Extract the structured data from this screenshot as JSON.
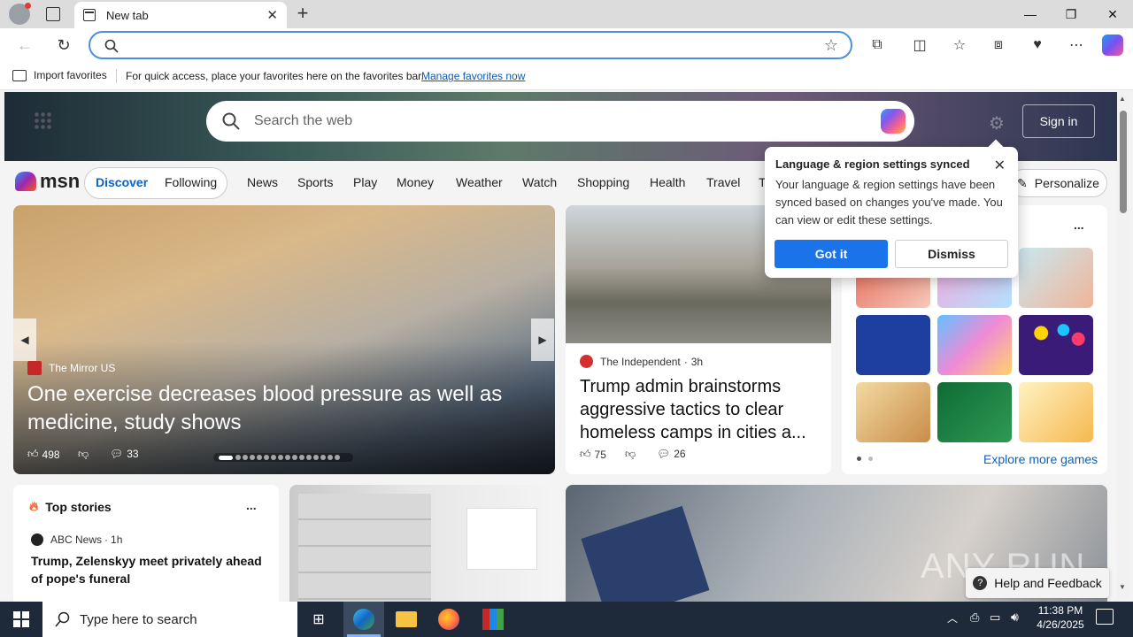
{
  "browser": {
    "tab_title": "New tab",
    "favorites_bar": {
      "import_label": "Import favorites",
      "hint": "For quick access, place your favorites here on the favorites bar.",
      "manage_link": "Manage favorites now"
    }
  },
  "msn": {
    "search_placeholder": "Search the web",
    "sign_in": "Sign in",
    "logo": "msn",
    "tabs": [
      "Discover",
      "Following"
    ],
    "nav": [
      "News",
      "Sports",
      "Play",
      "Money",
      "Weather",
      "Watch",
      "Shopping",
      "Health",
      "Travel",
      "T"
    ],
    "personalize": "Personalize",
    "hero_story": {
      "source": "The Mirror US",
      "headline": "One exercise decreases blood pressure as well as medicine, study shows",
      "likes": "498",
      "comments": "33"
    },
    "side_story": {
      "source": "The Independent",
      "age": "3h",
      "headline": "Trump admin brainstorms aggressive tactics to clear homeless camps in cities a...",
      "likes": "75",
      "comments": "26"
    },
    "games": {
      "explore": "Explore more games",
      "more": "..."
    },
    "top_stories": {
      "title": "Top stories",
      "more": "...",
      "source": "ABC News",
      "age": "1h",
      "headline": "Trump, Zelenskyy meet privately ahead of pope's funeral"
    },
    "help": "Help and Feedback",
    "watermark": "ANY RUN"
  },
  "popup": {
    "title": "Language & region settings synced",
    "body": "Your language & region settings have been synced based on changes you've made. You can view or edit these settings.",
    "ok": "Got it",
    "dismiss": "Dismiss"
  },
  "taskbar": {
    "search_placeholder": "Type here to search",
    "time": "11:38 PM",
    "date": "4/26/2025"
  },
  "colors": {
    "accent": "#1a73e8",
    "address_border": "#4a90e2",
    "taskbar": "#1e2a3a"
  }
}
